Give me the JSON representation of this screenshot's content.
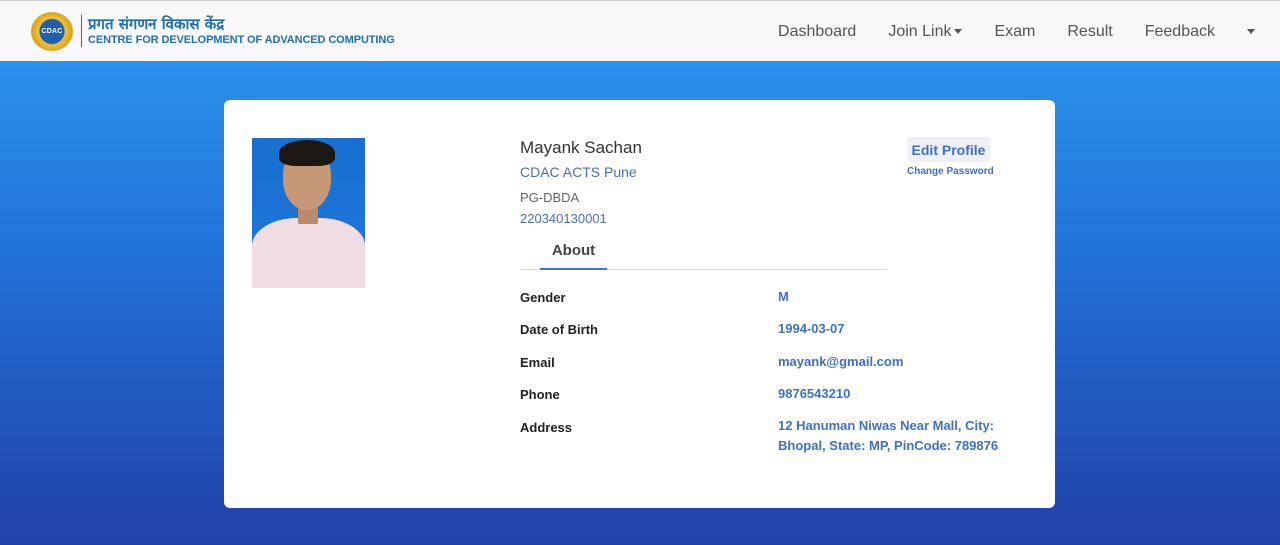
{
  "brand": {
    "logo_text": "CDAC",
    "hindi": "प्रगत संगणन विकास केंद्र",
    "english": "CENTRE FOR DEVELOPMENT OF ADVANCED COMPUTING"
  },
  "nav": {
    "dashboard": "Dashboard",
    "join_link": "Join Link",
    "exam": "Exam",
    "result": "Result",
    "feedback": "Feedback"
  },
  "profile": {
    "name": "Mayank Sachan",
    "org": "CDAC ACTS Pune",
    "course": "PG-DBDA",
    "prn": "220340130001",
    "edit_label": "Edit Profile",
    "change_password_label": "Change Password",
    "tab_about": "About"
  },
  "about": {
    "gender_label": "Gender",
    "gender": "M",
    "dob_label": "Date of Birth",
    "dob": "1994-03-07",
    "email_label": "Email",
    "email": "mayank@gmail.com",
    "phone_label": "Phone",
    "phone": "9876543210",
    "address_label": "Address",
    "address": "12 Hanuman Niwas Near Mall, City: Bhopal, State: MP, PinCode: 789876"
  }
}
